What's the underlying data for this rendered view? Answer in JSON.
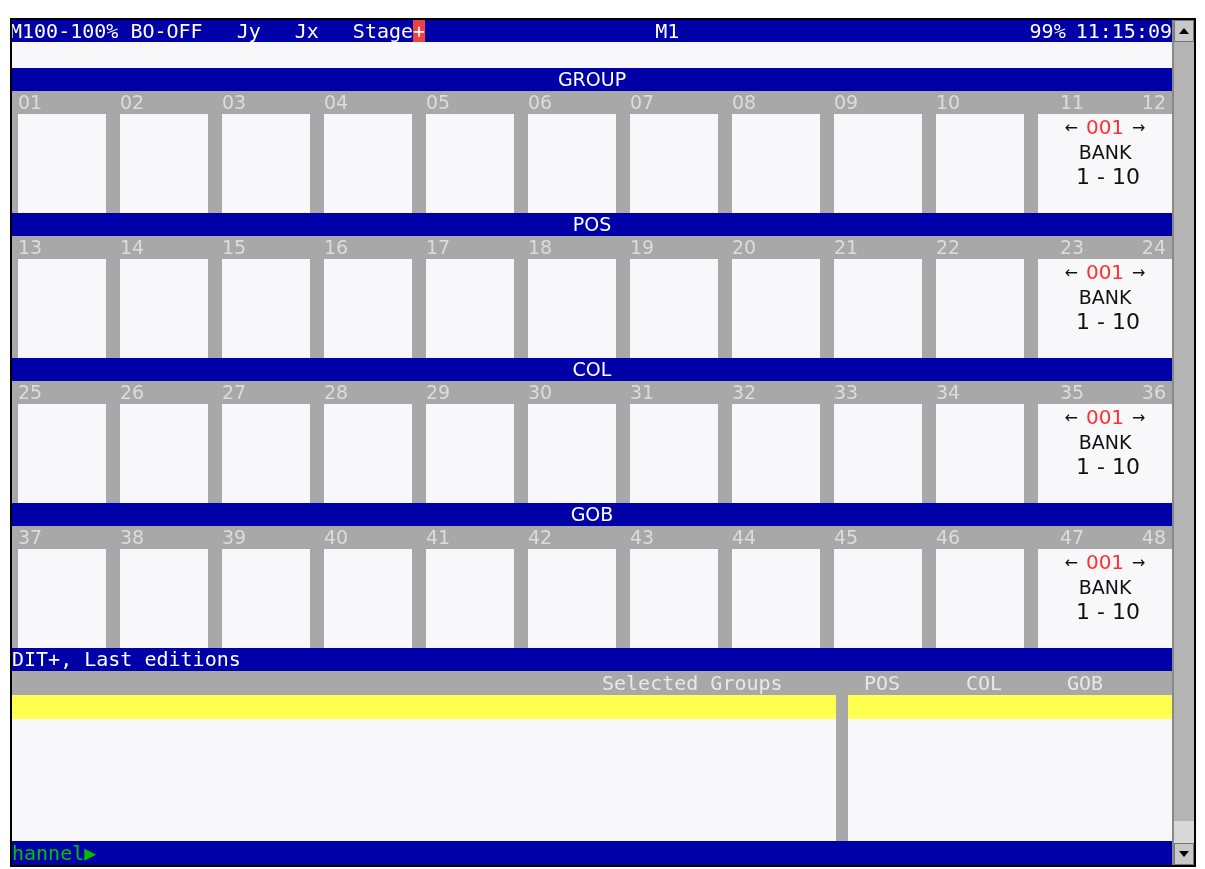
{
  "status_bar": {
    "items": [
      "M100-100% BO-OFF",
      "Jy",
      "Jx"
    ],
    "stage": "Stage",
    "stage_marker": "+",
    "memory": "M1",
    "level": "99%",
    "time": "11:15:09"
  },
  "sections": [
    {
      "title": "GROUP",
      "slots": [
        "01",
        "02",
        "03",
        "04",
        "05",
        "06",
        "07",
        "08",
        "09",
        "10"
      ],
      "bank": {
        "numbers": [
          "11",
          "12"
        ],
        "left_arrow": "←",
        "page": "001",
        "right_arrow": "→",
        "label": "BANK",
        "range": "1 - 10"
      }
    },
    {
      "title": "POS",
      "slots": [
        "13",
        "14",
        "15",
        "16",
        "17",
        "18",
        "19",
        "20",
        "21",
        "22"
      ],
      "bank": {
        "numbers": [
          "23",
          "24"
        ],
        "left_arrow": "←",
        "page": "001",
        "right_arrow": "→",
        "label": "BANK",
        "range": "1 - 10"
      }
    },
    {
      "title": "COL",
      "slots": [
        "25",
        "26",
        "27",
        "28",
        "29",
        "30",
        "31",
        "32",
        "33",
        "34"
      ],
      "bank": {
        "numbers": [
          "35",
          "36"
        ],
        "left_arrow": "←",
        "page": "001",
        "right_arrow": "→",
        "label": "BANK",
        "range": "1 - 10"
      }
    },
    {
      "title": "GOB",
      "slots": [
        "37",
        "38",
        "39",
        "40",
        "41",
        "42",
        "43",
        "44",
        "45",
        "46"
      ],
      "bank": {
        "numbers": [
          "47",
          "48"
        ],
        "left_arrow": "←",
        "page": "001",
        "right_arrow": "→",
        "label": "BANK",
        "range": "1 - 10"
      }
    }
  ],
  "edit_bar": "DIT+, Last editions",
  "columns": [
    "Selected Groups",
    "POS",
    "COL",
    "GOB"
  ],
  "command_line": {
    "text": "hannel",
    "prompt": "▶"
  }
}
